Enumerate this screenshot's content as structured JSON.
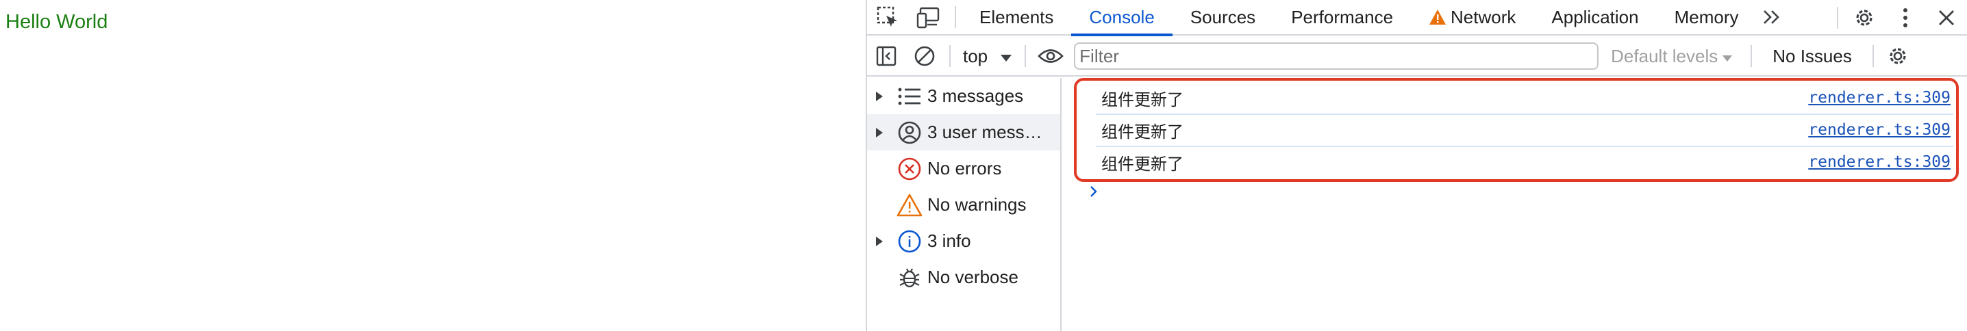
{
  "page": {
    "text": "Hello World"
  },
  "devtools": {
    "tabs": [
      {
        "label": "Elements"
      },
      {
        "label": "Console"
      },
      {
        "label": "Sources"
      },
      {
        "label": "Performance"
      },
      {
        "label": "Network"
      },
      {
        "label": "Application"
      },
      {
        "label": "Memory"
      }
    ],
    "active_tab": "Console",
    "more_tabs_icon": "double-chevron-right-icon",
    "toolbar": {
      "context": "top",
      "filter_placeholder": "Filter",
      "levels": "Default levels",
      "issues": "No Issues"
    },
    "sidebar": {
      "items": [
        {
          "label": "3 messages",
          "icon": "list-icon",
          "expandable": true
        },
        {
          "label": "3 user messages",
          "icon": "user-icon",
          "expandable": true
        },
        {
          "label": "No errors",
          "icon": "error-icon",
          "expandable": false
        },
        {
          "label": "No warnings",
          "icon": "warning-icon",
          "expandable": false
        },
        {
          "label": "3 info",
          "icon": "info-icon",
          "expandable": true
        },
        {
          "label": "No verbose",
          "icon": "bug-icon",
          "expandable": false
        }
      ]
    },
    "messages": [
      {
        "text": "组件更新了",
        "source": "renderer.ts:309"
      },
      {
        "text": "组件更新了",
        "source": "renderer.ts:309"
      },
      {
        "text": "组件更新了",
        "source": "renderer.ts:309"
      }
    ],
    "colors": {
      "accent": "#0b57d0",
      "highlight_border": "#e03a25",
      "hello_text": "#1a7f12",
      "error": "#d93025",
      "warning": "#e8710a"
    }
  }
}
